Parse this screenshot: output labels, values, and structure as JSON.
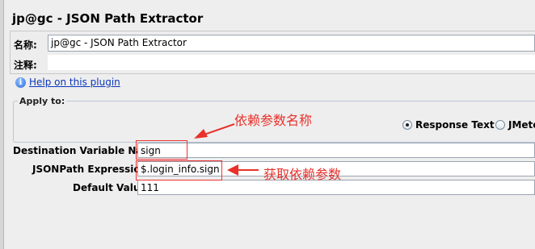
{
  "panel": {
    "title": "jp@gc - JSON Path Extractor",
    "name_label": "名称:",
    "name_value": "jp@gc - JSON Path Extractor",
    "comment_label": "注释:",
    "comment_value": "",
    "help_link": "Help on this plugin"
  },
  "apply_to": {
    "legend": "Apply to:",
    "options": [
      {
        "label": "Response Text",
        "selected": true
      },
      {
        "label": "JMete",
        "selected": false
      }
    ]
  },
  "fields": {
    "dest_label": "Destination Variable Name:",
    "dest_value": "sign",
    "jsonpath_label": "JSONPath Expression:",
    "jsonpath_value": "$.login_info.sign",
    "default_label": "Default Value:",
    "default_value": "111"
  },
  "annotations": {
    "var_name_note": "依赖参数名称",
    "jsonpath_note": "获取依赖参数",
    "color": "#e8312b"
  },
  "icons": {
    "help": "info-icon"
  }
}
